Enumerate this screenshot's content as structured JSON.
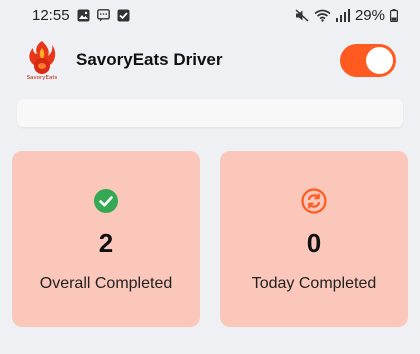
{
  "status": {
    "time": "12:55",
    "battery": "29%"
  },
  "header": {
    "title": "SavoryEats Driver",
    "logo_text": "SavoryEats",
    "toggle_on": true
  },
  "stats": [
    {
      "count": "2",
      "label": "Overall Completed",
      "icon": "check-circle-icon",
      "icon_color": "#34a853"
    },
    {
      "count": "0",
      "label": "Today Completed",
      "icon": "refresh-circle-icon",
      "icon_color": "#ff5a1f"
    }
  ],
  "colors": {
    "accent": "#ff5a1f",
    "card_bg": "#fbc7bb",
    "page_bg": "#eef0f4"
  }
}
